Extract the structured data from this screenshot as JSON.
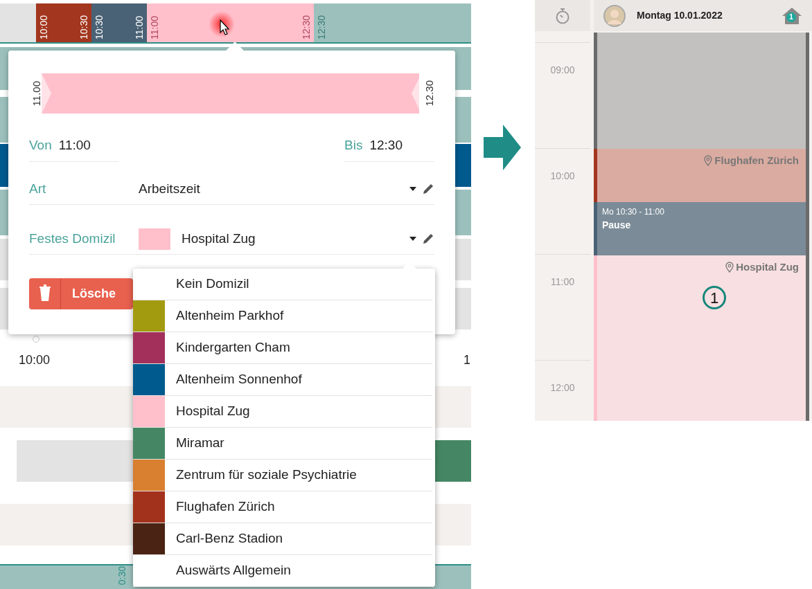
{
  "timeline_bar": {
    "segments": [
      {
        "color": "#a3361e",
        "start": "10:00",
        "end": "10:30"
      },
      {
        "color": "#4a6275",
        "start": "10:30",
        "end": "11:00"
      },
      {
        "color": "#ffc0cc",
        "start": "11:00",
        "end": "12:30"
      },
      {
        "color": "#9cc1bd",
        "start": "12:30"
      }
    ]
  },
  "popup": {
    "range": {
      "start": "11.00",
      "end": "12.30"
    },
    "from": {
      "label": "Von",
      "value": "11:00"
    },
    "to": {
      "label": "Bis",
      "value": "12:30"
    },
    "type": {
      "label": "Art",
      "value": "Arbeitszeit"
    },
    "domicile": {
      "label": "Festes Domizil",
      "value": "Hospital Zug",
      "color": "#ffc0cc"
    },
    "delete_button": "Lösche"
  },
  "dropdown": {
    "options": [
      {
        "label": "Kein Domizil"
      },
      {
        "label": "Altenheim Parkhof",
        "color": "#a39b0f"
      },
      {
        "label": "Kindergarten Cham",
        "color": "#a3305a"
      },
      {
        "label": "Altenheim Sonnenhof",
        "color": "#005a8e"
      },
      {
        "label": "Hospital Zug",
        "color": "#ffc0cc"
      },
      {
        "label": "Miramar",
        "color": "#458764"
      },
      {
        "label": "Zentrum für soziale Psychiatrie",
        "color": "#d97f30"
      },
      {
        "label": "Flughafen Zürich",
        "color": "#a3321c"
      },
      {
        "label": "Carl-Benz Stadion",
        "color": "#4a2314"
      },
      {
        "label": "Auswärts Allgemein"
      }
    ]
  },
  "background": {
    "time_label": "10:00",
    "cut_label": "1",
    "bar_label": "0:30"
  },
  "day_view": {
    "date": "Montag 10.01.2022",
    "badge": "1",
    "hours": [
      "09:00",
      "10:00",
      "11:00",
      "12:00"
    ],
    "events": [
      {
        "kind": "blocked"
      },
      {
        "kind": "location",
        "location": "Flughafen Zürich",
        "color": "#a3361e"
      },
      {
        "kind": "break",
        "time": "Mo 10:30 - 11:00",
        "title": "Pause",
        "color": "#4a6275"
      },
      {
        "kind": "location",
        "location": "Hospital Zug",
        "color": "#ffc0cc"
      }
    ],
    "callout": "1"
  }
}
